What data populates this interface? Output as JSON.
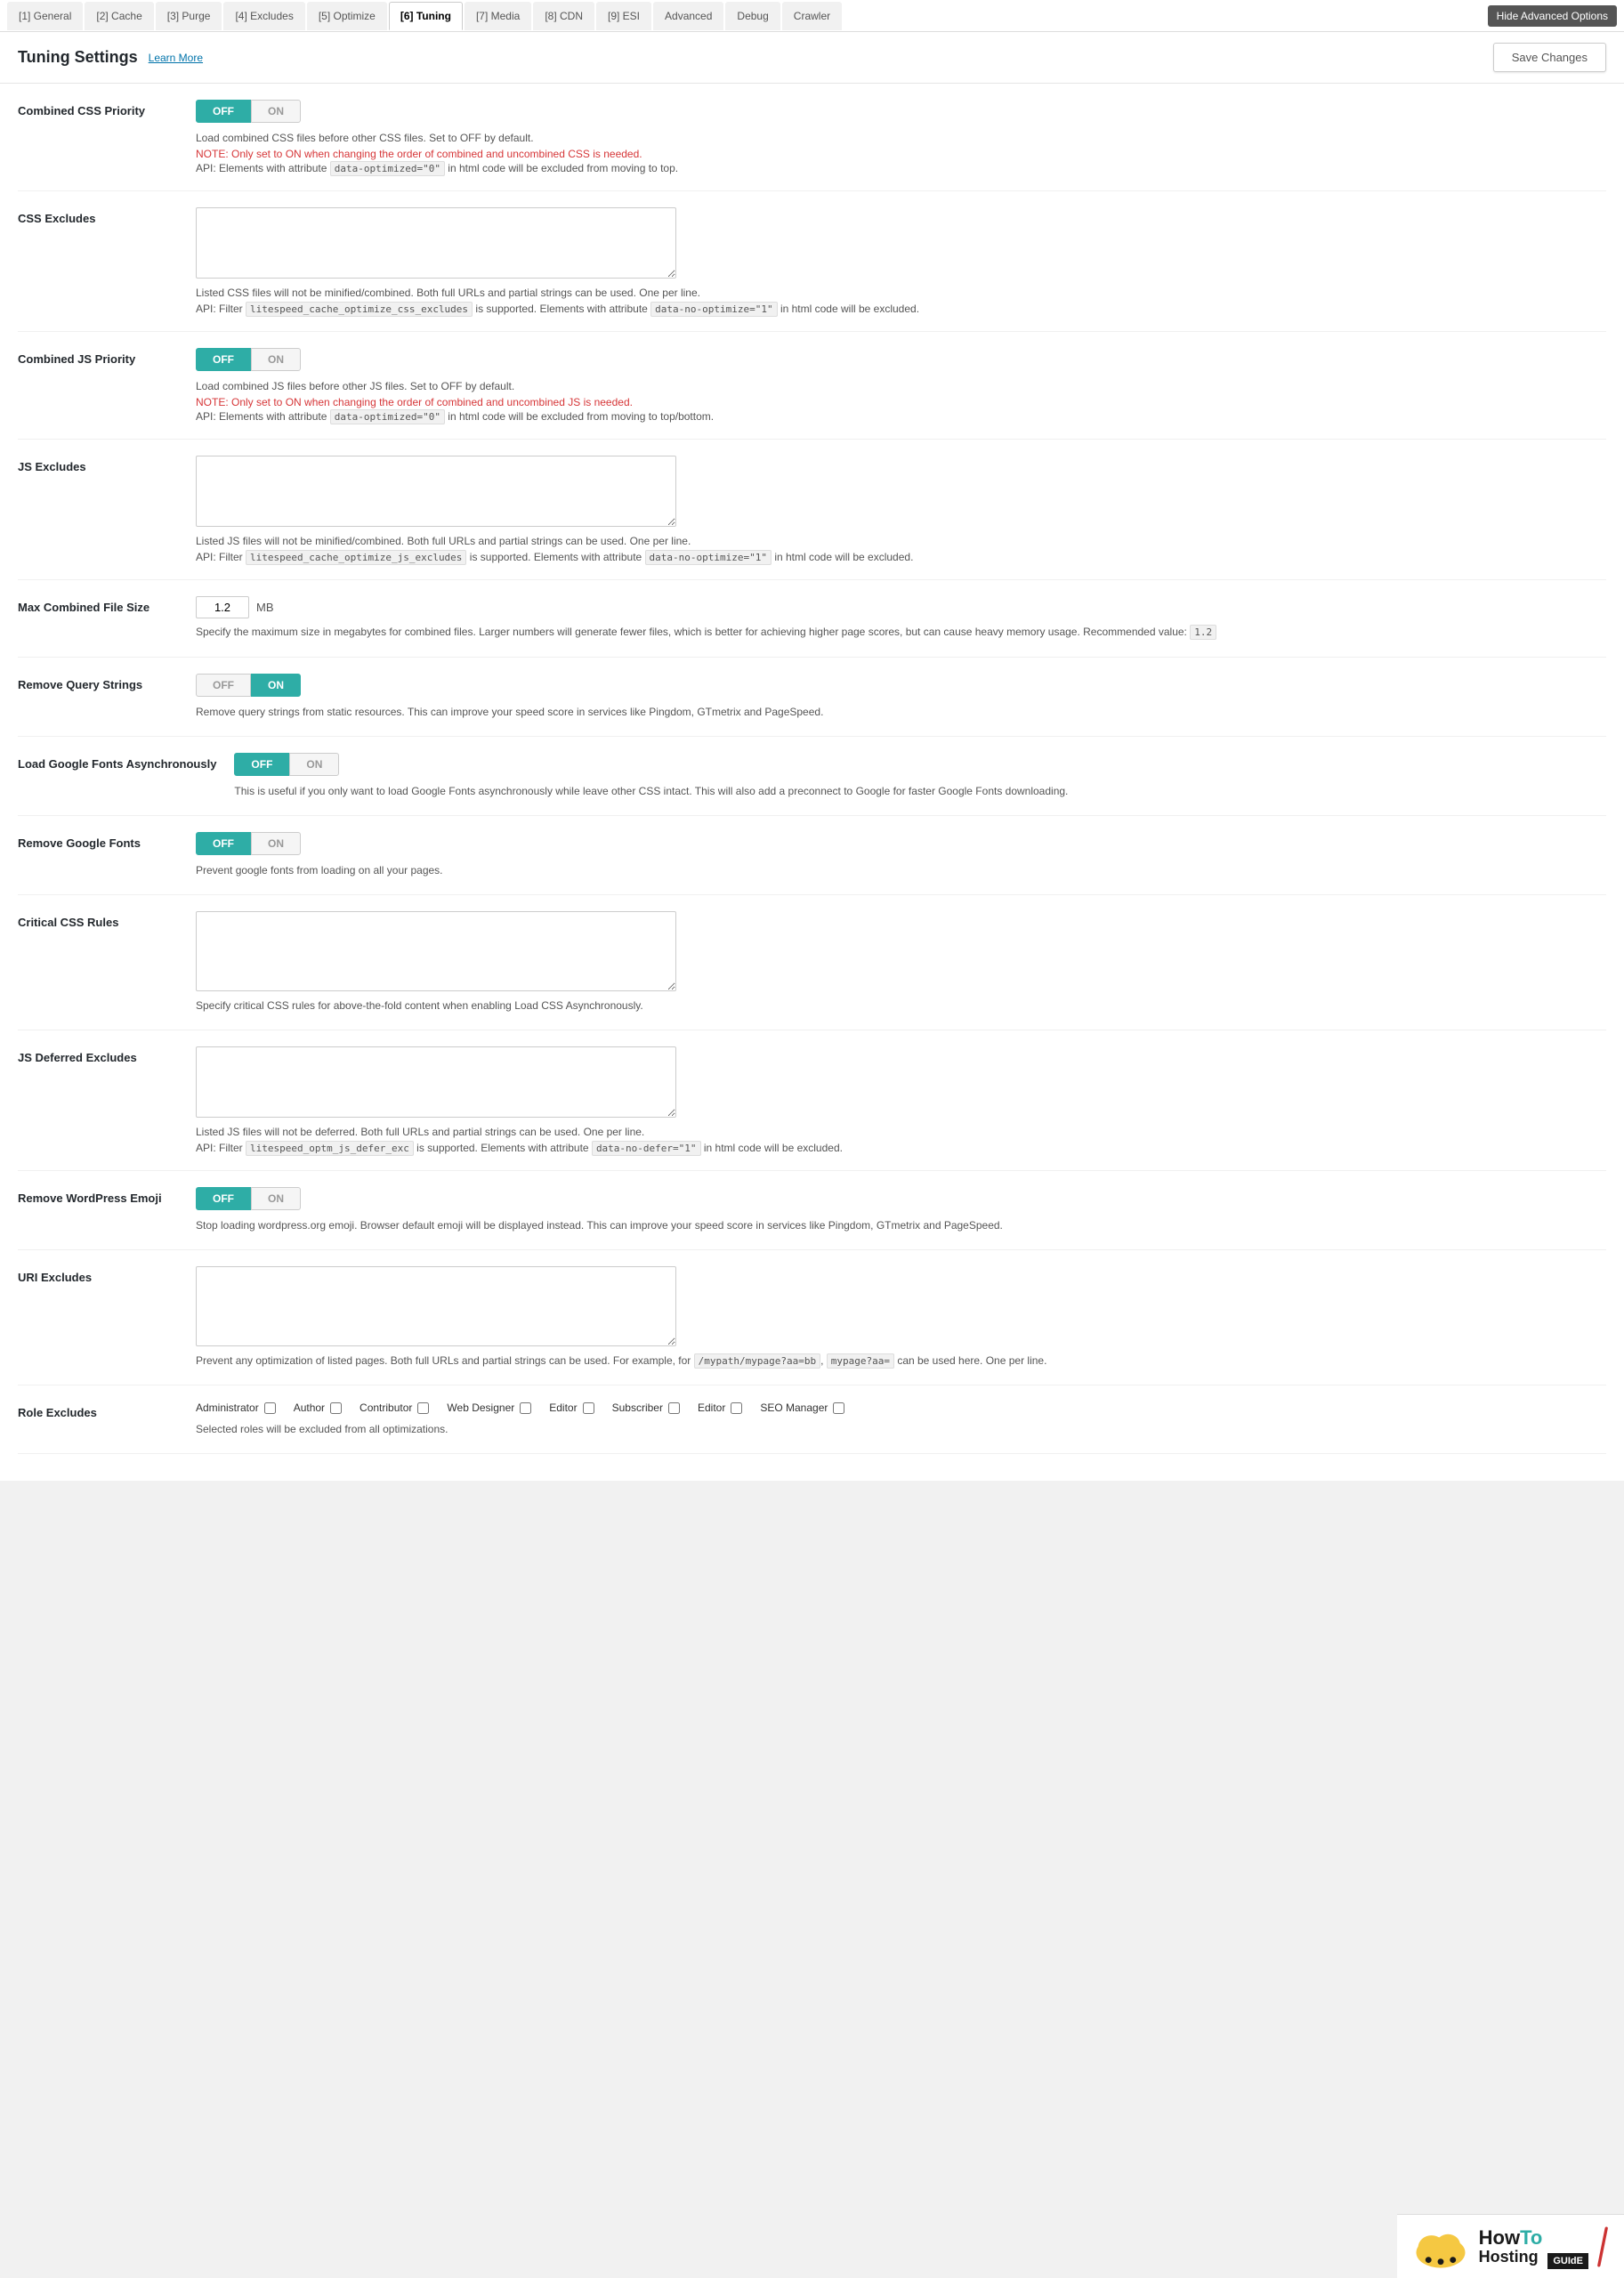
{
  "nav": {
    "tabs": [
      {
        "id": "general",
        "label": "[1] General"
      },
      {
        "id": "cache",
        "label": "[2] Cache"
      },
      {
        "id": "purge",
        "label": "[3] Purge"
      },
      {
        "id": "excludes",
        "label": "[4] Excludes"
      },
      {
        "id": "optimize",
        "label": "[5] Optimize"
      },
      {
        "id": "tuning",
        "label": "[6] Tuning"
      },
      {
        "id": "media",
        "label": "[7] Media"
      },
      {
        "id": "cdn",
        "label": "[8] CDN"
      },
      {
        "id": "esi",
        "label": "[9] ESI"
      },
      {
        "id": "advanced",
        "label": "Advanced"
      },
      {
        "id": "debug",
        "label": "Debug"
      },
      {
        "id": "crawler",
        "label": "Crawler"
      }
    ],
    "active_tab": "tuning",
    "hide_btn_label": "Hide Advanced Options"
  },
  "page": {
    "title": "Tuning Settings",
    "learn_more": "Learn More",
    "save_btn": "Save Changes"
  },
  "settings": {
    "combined_css_priority": {
      "label": "Combined CSS Priority",
      "toggle_off": "OFF",
      "toggle_on": "ON",
      "active": "off",
      "desc1": "Load combined CSS files before other CSS files. Set to OFF by default.",
      "desc_note": "NOTE: Only set to ON when changing the order of combined and uncombined CSS is needed.",
      "desc_api": "API: Elements with attribute",
      "desc_api_code": "data-optimized=\"0\"",
      "desc_api_suffix": " in html code will be excluded from moving to top."
    },
    "css_excludes": {
      "label": "CSS Excludes",
      "placeholder": "",
      "desc1": "Listed CSS files will not be minified/combined. Both full URLs and partial strings can be used. One per line.",
      "desc_api": "API: Filter",
      "desc_api_code1": "litespeed_cache_optimize_css_excludes",
      "desc_api_mid": "is supported. Elements with attribute",
      "desc_api_code2": "data-no-optimize=\"1\"",
      "desc_api_suffix": " in html code will be excluded."
    },
    "combined_js_priority": {
      "label": "Combined JS Priority",
      "toggle_off": "OFF",
      "toggle_on": "ON",
      "active": "off",
      "desc1": "Load combined JS files before other JS files. Set to OFF by default.",
      "desc_note": "NOTE: Only set to ON when changing the order of combined and uncombined JS is needed.",
      "desc_api": "API: Elements with attribute",
      "desc_api_code": "data-optimized=\"0\"",
      "desc_api_suffix": " in html code will be excluded from moving to top/bottom."
    },
    "js_excludes": {
      "label": "JS Excludes",
      "placeholder": "",
      "desc1": "Listed JS files will not be minified/combined. Both full URLs and partial strings can be used. One per line.",
      "desc_api": "API: Filter",
      "desc_api_code1": "litespeed_cache_optimize_js_excludes",
      "desc_api_mid": "is supported. Elements with attribute",
      "desc_api_code2": "data-no-optimize=\"1\"",
      "desc_api_suffix": " in html code will be excluded."
    },
    "max_combined_file_size": {
      "label": "Max Combined File Size",
      "value": "1.2",
      "unit": "MB",
      "desc1": "Specify the maximum size in megabytes for combined files. Larger numbers will generate fewer files, which is better for achieving higher page scores, but can cause heavy memory usage. Recommended value:",
      "recommended": "1.2"
    },
    "remove_query_strings": {
      "label": "Remove Query Strings",
      "toggle_off": "OFF",
      "toggle_on": "ON",
      "active": "on",
      "desc1": "Remove query strings from static resources. This can improve your speed score in services like Pingdom, GTmetrix and PageSpeed."
    },
    "load_google_fonts": {
      "label": "Load Google Fonts Asynchronously",
      "toggle_off": "OFF",
      "toggle_on": "ON",
      "active": "off",
      "desc1": "This is useful if you only want to load Google Fonts asynchronously while leave other CSS intact. This will also add a preconnect to Google for faster Google Fonts downloading."
    },
    "remove_google_fonts": {
      "label": "Remove Google Fonts",
      "toggle_off": "OFF",
      "toggle_on": "ON",
      "active": "off",
      "desc1": "Prevent google fonts from loading on all your pages."
    },
    "critical_css_rules": {
      "label": "Critical CSS Rules",
      "placeholder": "",
      "desc1": "Specify critical CSS rules for above-the-fold content when enabling Load CSS Asynchronously."
    },
    "js_deferred_excludes": {
      "label": "JS Deferred Excludes",
      "placeholder": "",
      "desc1": "Listed JS files will not be deferred. Both full URLs and partial strings can be used. One per line.",
      "desc_api": "API: Filter",
      "desc_api_code1": "litespeed_optm_js_defer_exc",
      "desc_api_mid": "is supported. Elements with attribute",
      "desc_api_code2": "data-no-defer=\"1\"",
      "desc_api_suffix": " in html code will be excluded."
    },
    "remove_wordpress_emoji": {
      "label": "Remove WordPress Emoji",
      "toggle_off": "OFF",
      "toggle_on": "ON",
      "active": "off",
      "desc1": "Stop loading wordpress.org emoji. Browser default emoji will be displayed instead. This can improve your speed score in services like Pingdom, GTmetrix and PageSpeed."
    },
    "uri_excludes": {
      "label": "URI Excludes",
      "placeholder": "",
      "desc1": "Prevent any optimization of listed pages. Both full URLs and partial strings can be used. For example, for",
      "desc_code1": "/mypath/mypage?aa=bb",
      "desc_mid": ",",
      "desc_code2": "mypage?aa=",
      "desc_suffix": " can be used here. One per line."
    },
    "role_excludes": {
      "label": "Role Excludes",
      "roles": [
        {
          "id": "administrator",
          "label": "Administrator",
          "checked": false
        },
        {
          "id": "author",
          "label": "Author",
          "checked": false
        },
        {
          "id": "contributor",
          "label": "Contributor",
          "checked": false
        },
        {
          "id": "web_designer",
          "label": "Web Designer",
          "checked": false
        },
        {
          "id": "editor",
          "label": "Editor",
          "checked": false
        },
        {
          "id": "subscriber",
          "label": "Subscriber",
          "checked": false
        },
        {
          "id": "editor2",
          "label": "Editor",
          "checked": false
        },
        {
          "id": "seo_manager",
          "label": "SEO Manager",
          "checked": false
        }
      ],
      "desc1": "Selected roles will be excluded from all optimizations."
    }
  },
  "branding": {
    "how": "HowTo",
    "hosting": "Hosting",
    "guide": "GUIdE"
  }
}
